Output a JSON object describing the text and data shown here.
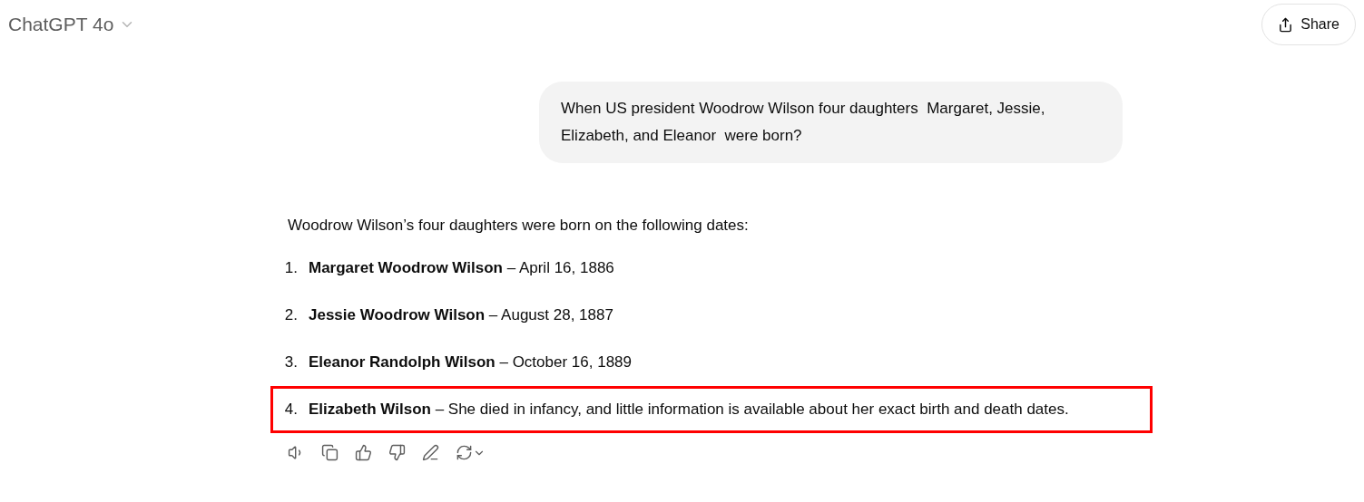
{
  "header": {
    "model": "ChatGPT 4o",
    "share": "Share"
  },
  "user_message": "When US president Woodrow Wilson four daughters  Margaret, Jessie, Elizabeth, and Eleanor  were born?",
  "response": {
    "intro": "Woodrow Wilson’s four daughters were born on the following dates:",
    "items": [
      {
        "number": "1.",
        "text": "**Margaret Woodrow Wilson** – April 16, 1886",
        "highlighted": false
      },
      {
        "number": "2.",
        "text": "**Jessie Woodrow Wilson** – August 28, 1887",
        "highlighted": false
      },
      {
        "number": "3.",
        "text": "**Eleanor Randolph Wilson** – October 16, 1889",
        "highlighted": false
      },
      {
        "number": "4.",
        "text": "**Elizabeth Wilson** – She died in infancy, and little information is available about her exact birth and death dates.",
        "highlighted": true
      }
    ]
  },
  "actions": [
    {
      "kind": "speaker"
    },
    {
      "kind": "copy"
    },
    {
      "kind": "thumbs-up"
    },
    {
      "kind": "thumbs-down"
    },
    {
      "kind": "edit"
    },
    {
      "kind": "regenerate"
    }
  ]
}
